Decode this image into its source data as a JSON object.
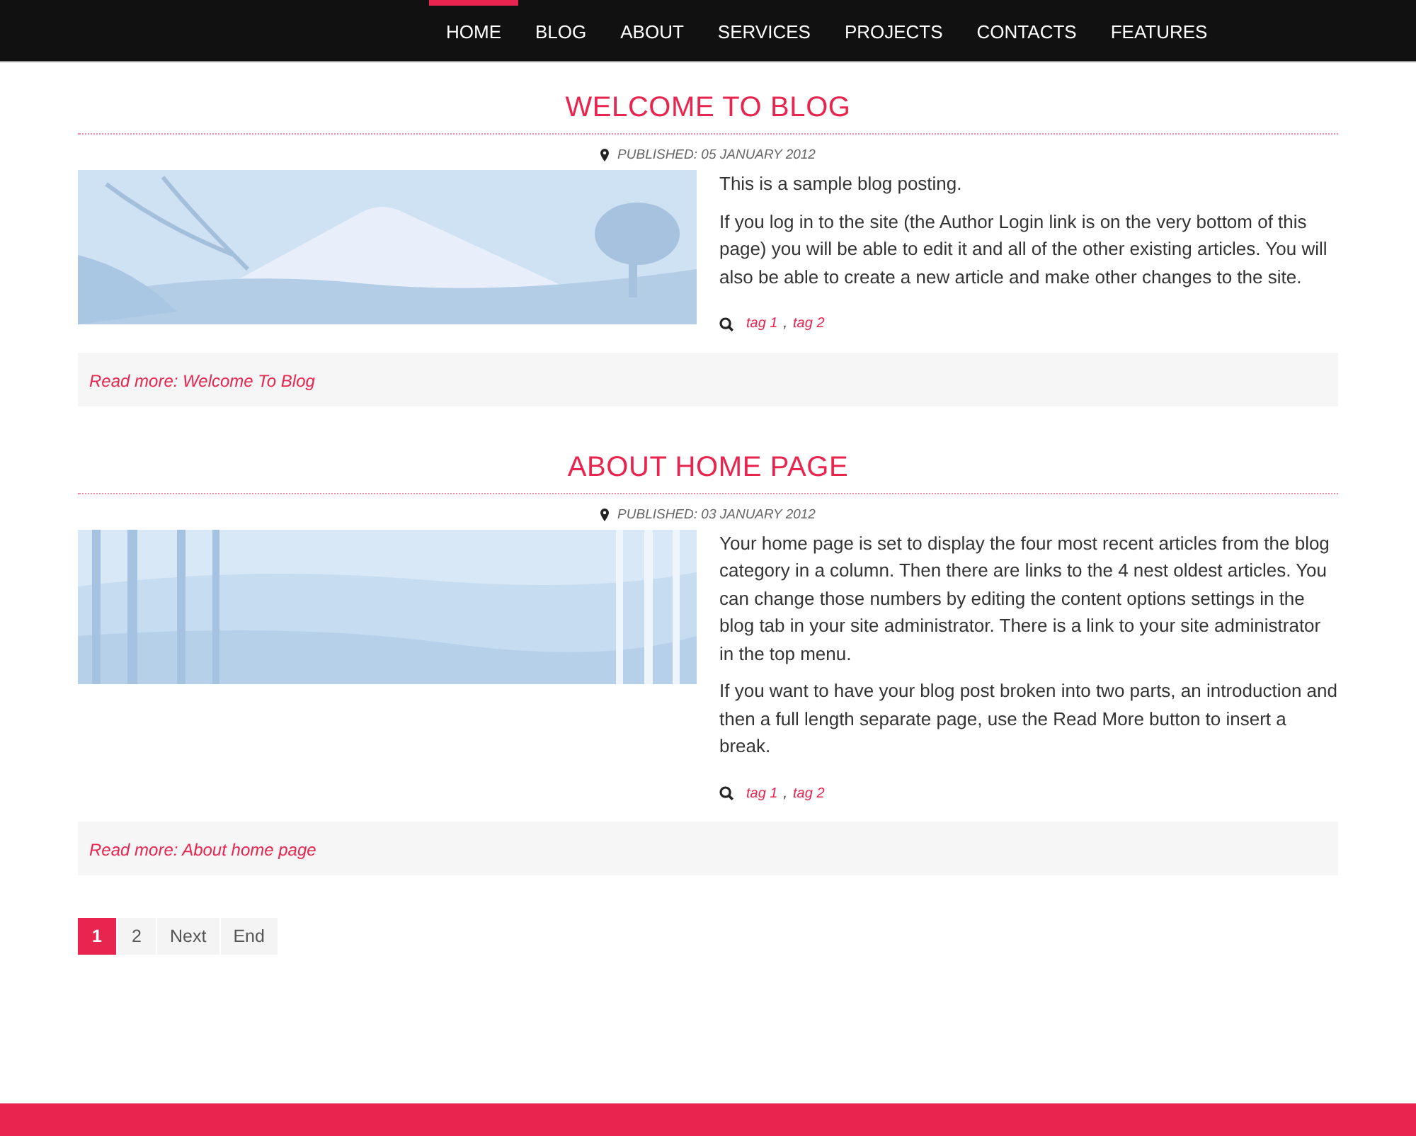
{
  "nav": [
    {
      "label": "HOME",
      "selected": true
    },
    {
      "label": "BLOG",
      "selected": false
    },
    {
      "label": "ABOUT",
      "selected": false
    },
    {
      "label": "SERVICES",
      "selected": false
    },
    {
      "label": "PROJECTS",
      "selected": false
    },
    {
      "label": "CONTACTS",
      "selected": false
    },
    {
      "label": "FEATURES",
      "selected": false
    }
  ],
  "articles": [
    {
      "title": "WELCOME TO BLOG",
      "published": "PUBLISHED: 05 JANUARY 2012",
      "image": {
        "kind": "mountain"
      },
      "paragraphs": [
        "This is a sample blog posting.",
        "If you log in to the site (the Author Login link is on the very bottom of this page) you will be able to edit it and all of the other existing articles. You will also be able to create a new article and make other changes to the site."
      ],
      "tags": [
        "tag 1",
        "tag 2"
      ],
      "tag_separator": ",",
      "read_more": "Read more: Welcome To Blog"
    },
    {
      "title": "ABOUT HOME PAGE",
      "published": "PUBLISHED: 03 JANUARY 2012",
      "image": {
        "kind": "bamboo"
      },
      "paragraphs": [
        "Your home page is set to display the four most recent articles from the blog category in a column. Then there are links to the 4 nest oldest articles. You can change those numbers by editing the content options settings in the blog tab in your site administrator. There is a link to your site administrator in the top menu.",
        "If you want to have your blog post broken into two parts, an introduction and then a full length separate page, use the Read More button to insert a break."
      ],
      "tags": [
        "tag 1",
        "tag 2"
      ],
      "tag_separator": ",",
      "read_more": "Read more: About home page"
    }
  ],
  "pagination": [
    {
      "label": "1",
      "selected": true
    },
    {
      "label": "2",
      "selected": false
    },
    {
      "label": "Next",
      "selected": false
    },
    {
      "label": "End",
      "selected": false
    }
  ]
}
